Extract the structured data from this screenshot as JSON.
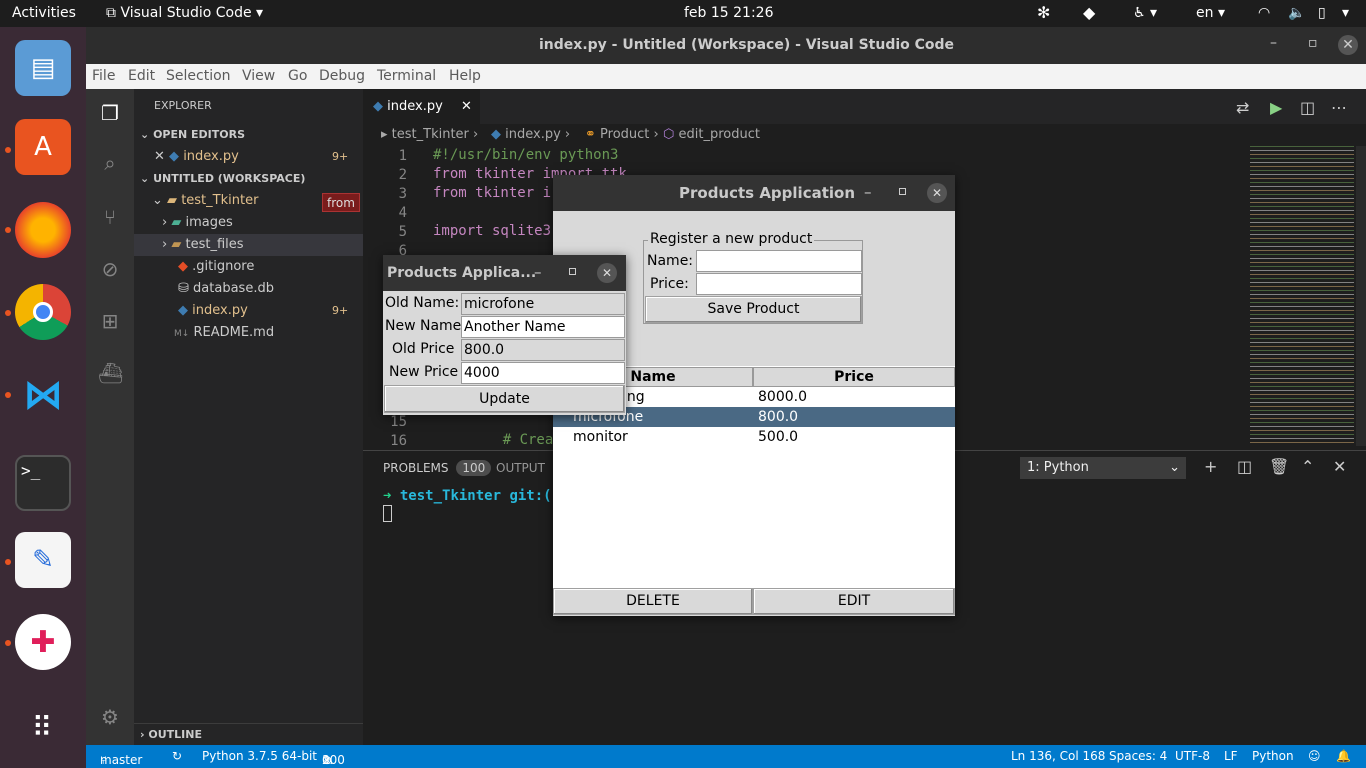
{
  "topbar": {
    "activities": "Activities",
    "app_menu": "Visual Studio Code",
    "clock": "feb 15  21:26",
    "lang": "en"
  },
  "vscode": {
    "window_title": "index.py - Untitled (Workspace) - Visual Studio Code",
    "menu": [
      "File",
      "Edit",
      "Selection",
      "View",
      "Go",
      "Debug",
      "Terminal",
      "Help"
    ],
    "explorer": {
      "title": "EXPLORER",
      "open_editors": "OPEN EDITORS",
      "open_file": "index.py",
      "open_file_badge": "9+",
      "workspace": "UNTITLED (WORKSPACE)",
      "folder": "test_Tkinter",
      "folder_tooltip": "from",
      "items": [
        "images",
        "test_files",
        ".gitignore",
        "database.db",
        "index.py",
        "README.md"
      ],
      "index_badge": "9+",
      "outline": "OUTLINE"
    },
    "tab": {
      "label": "index.py"
    },
    "breadcrumb": [
      "test_Tkinter",
      "index.py",
      "Product",
      "edit_product"
    ],
    "code_lines": [
      {
        "n": "1",
        "text": "#!/usr/bin/env python3"
      },
      {
        "n": "2",
        "text": "from tkinter import ttk"
      },
      {
        "n": "3",
        "text": "from tkinter i"
      },
      {
        "n": "4",
        "text": ""
      },
      {
        "n": "5",
        "text": "import sqlite3"
      },
      {
        "n": "6",
        "text": ""
      },
      {
        "n": "15",
        "text": ""
      },
      {
        "n": "16",
        "text": "    # Crea"
      }
    ],
    "panel": {
      "tab_problems": "PROBLEMS",
      "problems_count": "100",
      "tab_output": "OUTPUT",
      "terminal_select": "1: Python",
      "prompt": "test_Tkinter git:("
    },
    "status": {
      "branch": "master",
      "python": "Python 3.7.5 64-bit",
      "errors": "0",
      "warnings": "100",
      "position": "Ln 136, Col 168",
      "spaces": "Spaces: 4",
      "encoding": "UTF-8",
      "eol": "LF",
      "language": "Python"
    }
  },
  "products_window": {
    "title": "Products Application",
    "frame_label": "Register a new product",
    "name_label": "Name:",
    "price_label": "Price:",
    "name_value": "",
    "price_value": "",
    "save_button": "Save Product",
    "table_headers": [
      "Name",
      "Price"
    ],
    "rows": [
      {
        "name": "ing",
        "price": "8000.0",
        "selected": false
      },
      {
        "name": "microfone",
        "price": "800.0",
        "selected": true
      },
      {
        "name": "monitor",
        "price": "500.0",
        "selected": false
      }
    ],
    "delete_button": "DELETE",
    "edit_button": "EDIT"
  },
  "edit_window": {
    "title": "Products Applica...",
    "old_name_label": "Old Name:",
    "old_name_value": "microfone",
    "new_name_label": "New Name",
    "new_name_value": "Another Name",
    "old_price_label": "Old Price",
    "old_price_value": "800.0",
    "new_price_label": "New Price",
    "new_price_value": "4000",
    "update_button": "Update"
  },
  "colors": {
    "accent": "#007acc",
    "selection": "#4a6984",
    "terminal_prompt": "#23d18b",
    "terminal_text": "#29b8db"
  }
}
